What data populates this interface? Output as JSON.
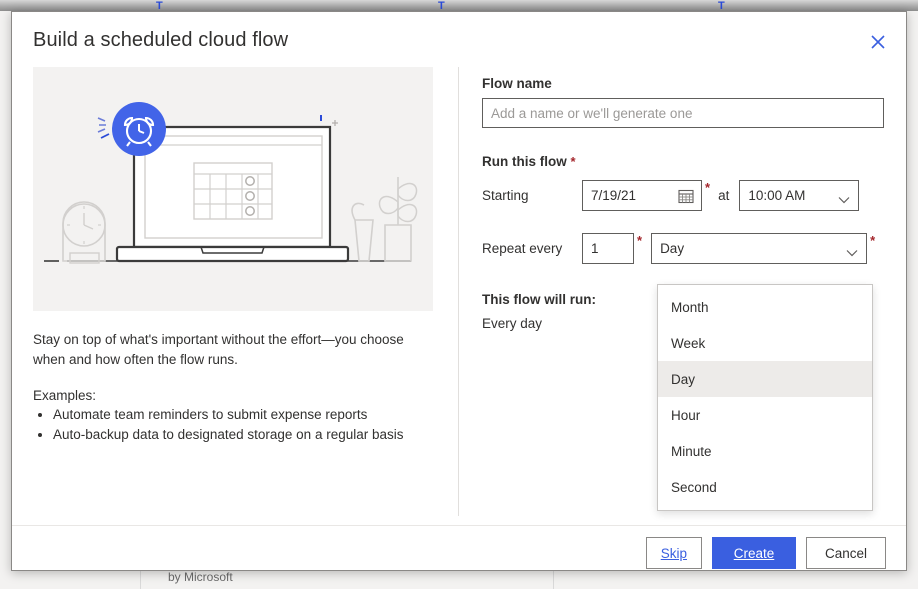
{
  "background": {
    "bottom_text": "by Microsoft",
    "tick_marks": [
      "T",
      "T",
      "T"
    ]
  },
  "dialog": {
    "title": "Build a scheduled cloud flow",
    "close_icon": "close-icon",
    "close_label": "Close"
  },
  "illustration": {
    "name": "scheduled-flow-illustration",
    "accent_color": "#4264e8",
    "background_color": "#f3f2f1",
    "line_color": "#333333",
    "alt": "Laptop with calendar on screen, alarm clock badge, mantel clock and plant"
  },
  "left_panel": {
    "description": "Stay on top of what's important without the effort—you choose when and how often the flow runs.",
    "examples_label": "Examples:",
    "examples": [
      "Automate team reminders to submit expense reports",
      "Auto-backup data to designated storage on a regular basis"
    ]
  },
  "form": {
    "flow_name": {
      "label": "Flow name",
      "value": "",
      "placeholder": "Add a name or we'll generate one"
    },
    "run_this_flow": {
      "label": "Run this flow",
      "required_marker": "*"
    },
    "starting": {
      "label": "Starting",
      "date_value": "7/19/21",
      "calendar_icon": "calendar-icon",
      "required_marker": "*",
      "at_label": "at",
      "time_value": "10:00 AM",
      "time_chevron_icon": "chevron-down-icon"
    },
    "repeat": {
      "label": "Repeat every",
      "interval_value": "1",
      "interval_required_marker": "*",
      "unit_value": "Day",
      "unit_required_marker": "*",
      "unit_chevron_icon": "chevron-down-icon",
      "options": [
        "Month",
        "Week",
        "Day",
        "Hour",
        "Minute",
        "Second"
      ],
      "selected_option": "Day"
    },
    "summary": {
      "label": "This flow will run:",
      "value": "Every day"
    }
  },
  "footer": {
    "skip_label": "Skip",
    "create_label": "Create",
    "cancel_label": "Cancel",
    "primary_color": "#3a5fe0"
  }
}
